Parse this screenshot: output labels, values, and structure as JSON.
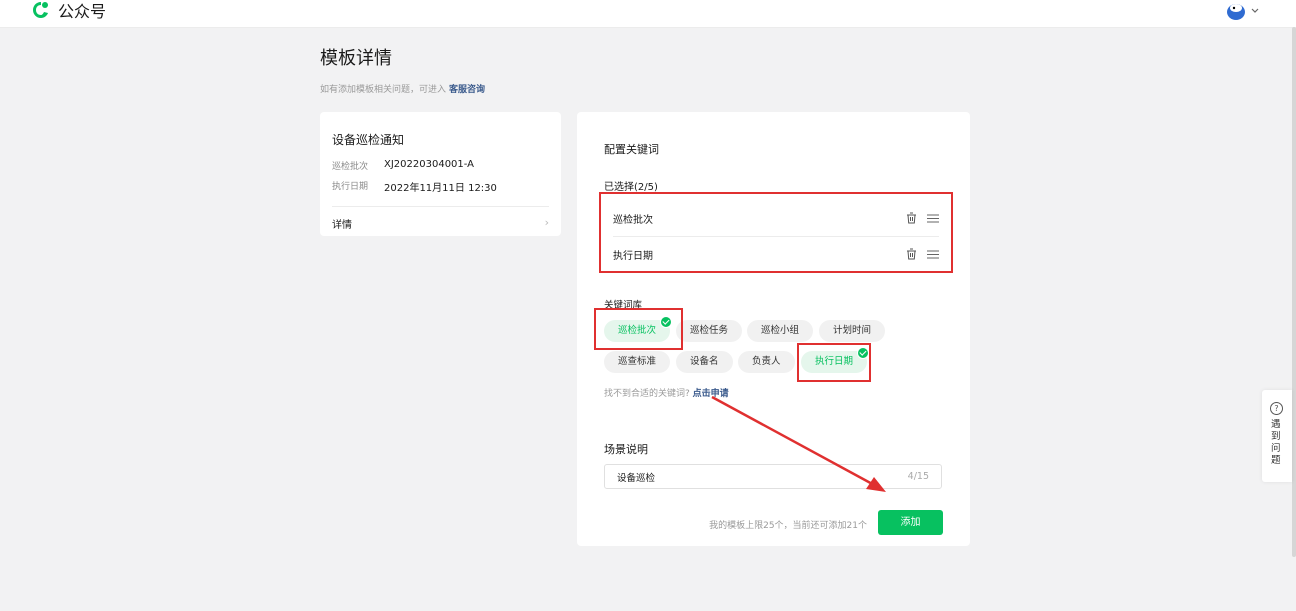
{
  "topbar": {
    "brand": "公众号"
  },
  "page": {
    "title": "模板详情",
    "hint_prefix": "如有添加模板相关问题，可进入",
    "hint_link": "客服咨询"
  },
  "template_card": {
    "title": "设备巡检通知",
    "fields": [
      {
        "key": "巡检批次",
        "value": "XJ20220304001-A"
      },
      {
        "key": "执行日期",
        "value": "2022年11月11日 12:30"
      }
    ],
    "detail_label": "详情"
  },
  "config": {
    "heading": "配置关键词",
    "selected_label": "已选择(2/5)",
    "selected": [
      "巡检批次",
      "执行日期"
    ],
    "library_label": "关键词库",
    "library": [
      {
        "label": "巡检批次",
        "selected": true
      },
      {
        "label": "巡检任务",
        "selected": false
      },
      {
        "label": "巡检小组",
        "selected": false
      },
      {
        "label": "计划时间",
        "selected": false
      },
      {
        "label": "巡查标准",
        "selected": false
      },
      {
        "label": "设备名",
        "selected": false
      },
      {
        "label": "负责人",
        "selected": false
      },
      {
        "label": "执行日期",
        "selected": true
      }
    ],
    "notfound_prefix": "找不到合适的关键词?",
    "notfound_link": "点击申请",
    "scene_label": "场景说明",
    "scene_value": "设备巡检",
    "scene_count": "4/15",
    "limit_text": "我的模板上限25个，当前还可添加21个",
    "add_label": "添加"
  },
  "help": {
    "text": "遇到问题",
    "icon_glyph": "?"
  },
  "colors": {
    "accent": "#07c160",
    "annotation": "#e03030",
    "link": "#3a5a8c"
  },
  "icons": [
    "logo-icon",
    "avatar-icon",
    "chevron-right-icon",
    "trash-icon",
    "drag-handle-icon",
    "check-icon",
    "question-icon"
  ]
}
